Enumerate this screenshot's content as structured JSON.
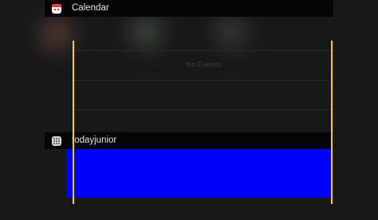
{
  "widgets": [
    {
      "label": "Calendar",
      "icon": "calendar-icon"
    },
    {
      "label": "todayjunior",
      "icon": "app-grid-icon"
    }
  ],
  "calendar": {
    "empty_text": "No Events"
  },
  "colors": {
    "background": "#181818",
    "header": "#050505",
    "highlight_box": "#0000ff",
    "guide_lines": "#ffd400",
    "calendar_icon_top": "#e8403a"
  }
}
